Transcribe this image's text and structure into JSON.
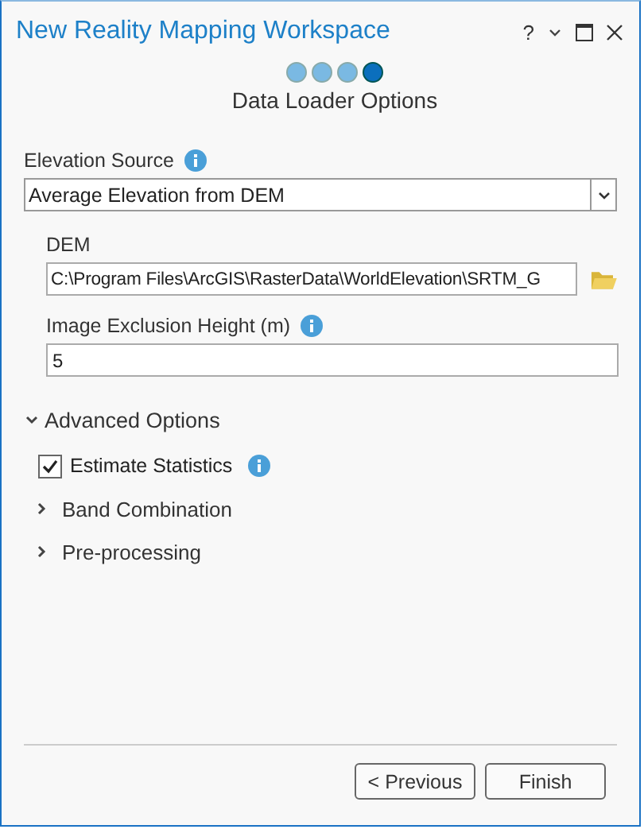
{
  "window": {
    "title": "New Reality Mapping Workspace",
    "help": "?"
  },
  "steps": [
    {
      "selected": false
    },
    {
      "selected": false
    },
    {
      "selected": false
    },
    {
      "selected": true
    }
  ],
  "page_title": "Data Loader Options",
  "elevation_source": {
    "label": "Elevation Source",
    "value": "Average Elevation from DEM"
  },
  "dem": {
    "label": "DEM",
    "value": "C:\\Program Files\\ArcGIS\\RasterData\\WorldElevation\\SRTM_G"
  },
  "exclusion_height": {
    "label": "Image Exclusion Height (m)",
    "value": "5"
  },
  "advanced": {
    "label": "Advanced Options",
    "expanded": true,
    "estimate_statistics": {
      "label": "Estimate Statistics",
      "checked": true
    },
    "sections": [
      {
        "label": "Band Combination",
        "expanded": false
      },
      {
        "label": "Pre-processing",
        "expanded": false
      }
    ]
  },
  "buttons": [
    {
      "label": "< Previous"
    },
    {
      "label": "Finish"
    }
  ]
}
